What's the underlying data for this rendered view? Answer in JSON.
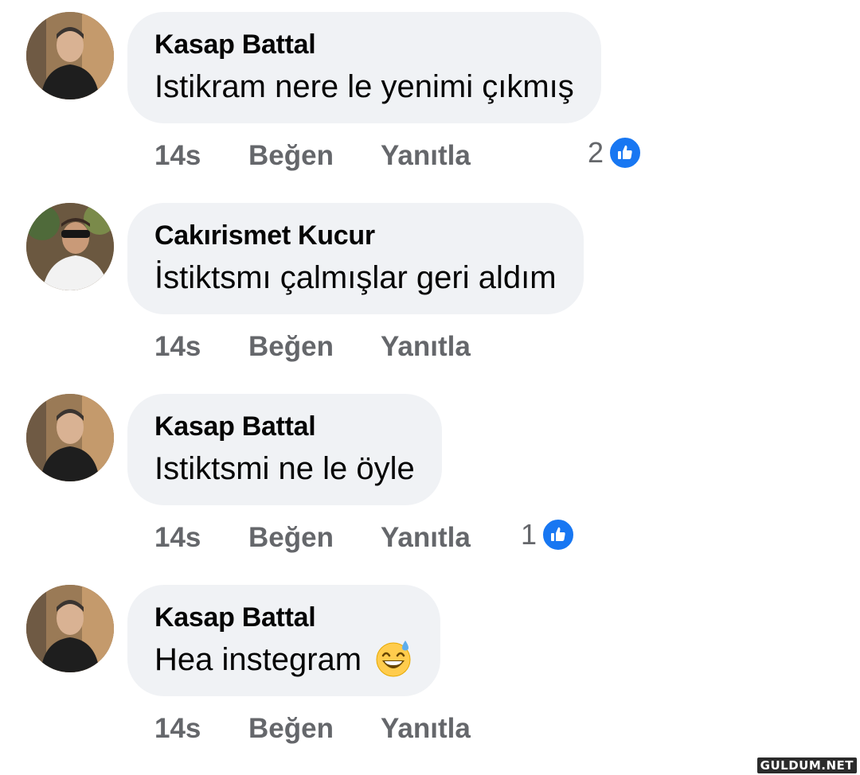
{
  "comments": [
    {
      "author": "Kasap Battal",
      "text": "Istikram nere le yenimi çıkmış",
      "time": "14s",
      "like": "Beğen",
      "reply": "Yanıtla",
      "reaction_count": "2",
      "emoji": ""
    },
    {
      "author": "Cakırismet Kucur",
      "text": "İstiktsmı çalmışlar geri aldım",
      "time": "14s",
      "like": "Beğen",
      "reply": "Yanıtla",
      "reaction_count": "",
      "emoji": ""
    },
    {
      "author": "Kasap Battal",
      "text": "Istiktsmi ne le öyle",
      "time": "14s",
      "like": "Beğen",
      "reply": "Yanıtla",
      "reaction_count": "1",
      "emoji": ""
    },
    {
      "author": "Kasap Battal",
      "text": "Hea instegram",
      "time": "14s",
      "like": "Beğen",
      "reply": "Yanıtla",
      "reaction_count": "",
      "emoji": "grinning-sweat-emoji"
    }
  ],
  "watermark": "GULDUM.NET",
  "colors": {
    "bubble": "#f0f2f5",
    "action_text": "#65676b",
    "like_blue": "#1877f2"
  }
}
